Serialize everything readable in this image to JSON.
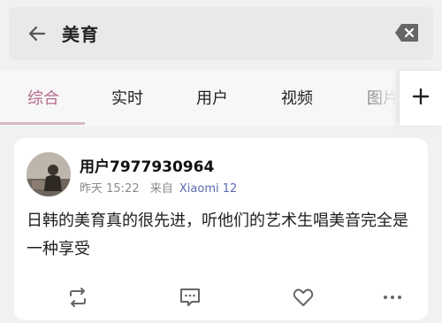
{
  "search": {
    "query": "美育"
  },
  "tabs": [
    {
      "label": "综合",
      "active": true
    },
    {
      "label": "实时",
      "active": false
    },
    {
      "label": "用户",
      "active": false
    },
    {
      "label": "视频",
      "active": false
    },
    {
      "label": "图片",
      "active": false
    }
  ],
  "post": {
    "username": "用户7977930964",
    "time": "昨天 15:22",
    "from_label": "来自",
    "device": "Xiaomi 12",
    "text": "日韩的美育真的很先进，听他们的艺术生唱美音完全是一种享受"
  },
  "icons": [
    "back-arrow-icon",
    "clear-input-icon",
    "add-icon",
    "repost-icon",
    "comment-icon",
    "like-icon",
    "more-icon"
  ],
  "colors": {
    "active_tab": "#b56a8b",
    "device_link": "#5b6bb0",
    "background": "#f1f1f1"
  }
}
